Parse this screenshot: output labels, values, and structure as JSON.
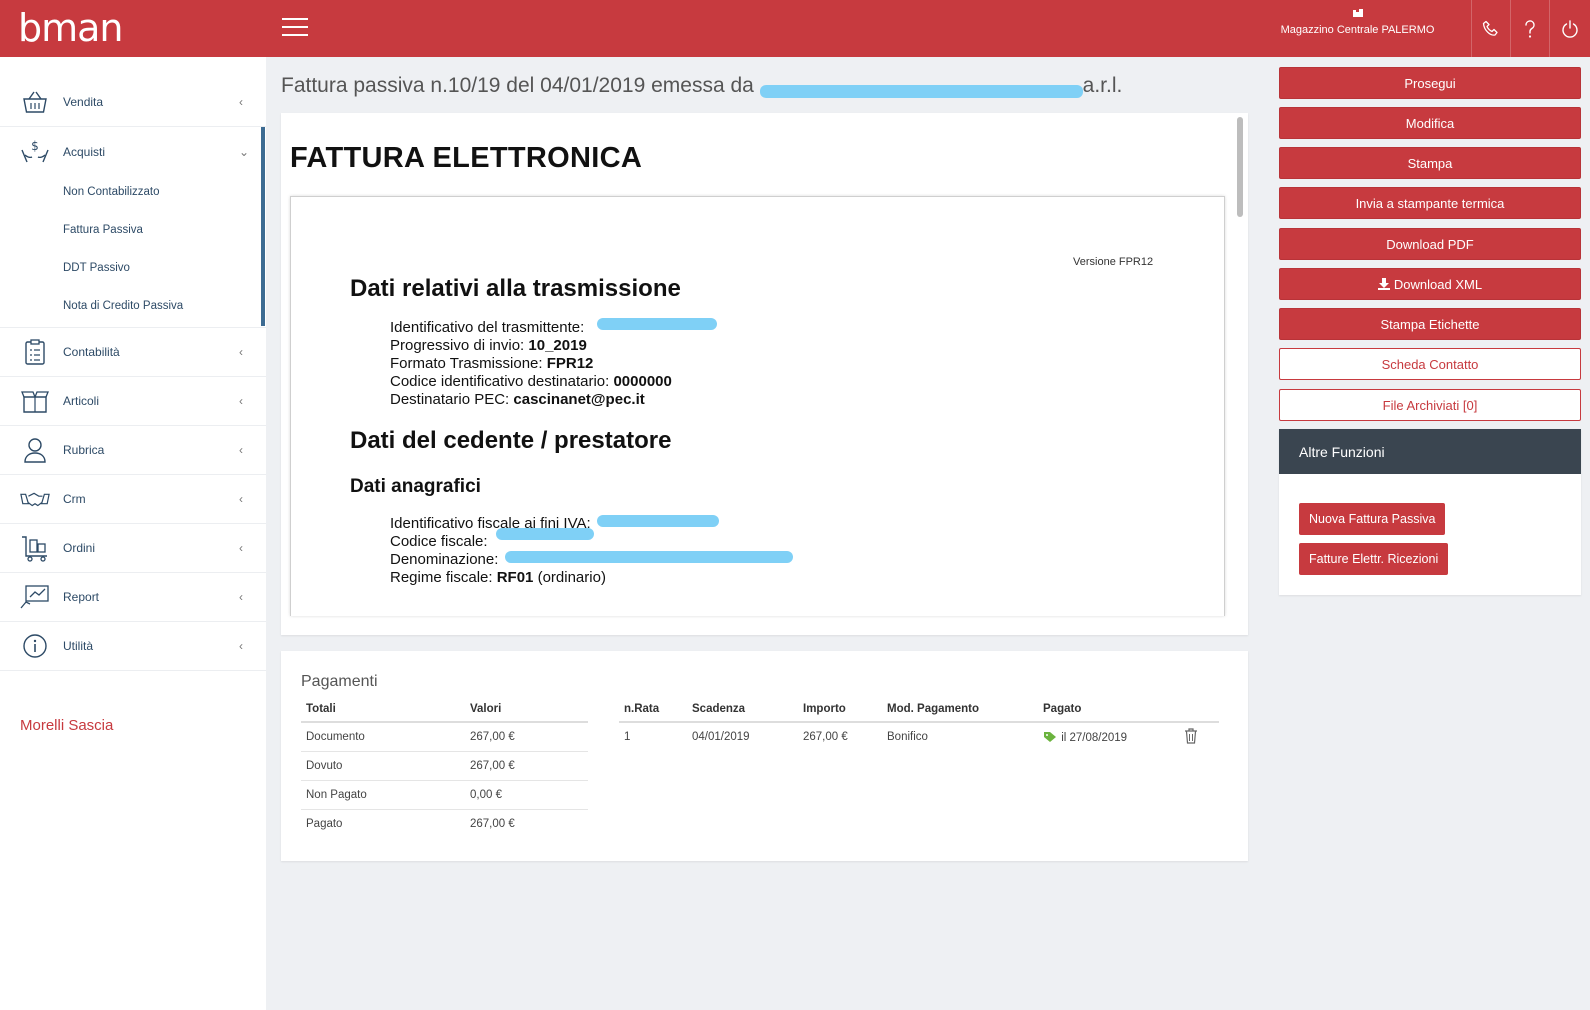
{
  "app": {
    "logo": "bman"
  },
  "header": {
    "warehouse": "Magazzino Centrale PALERMO",
    "icons": [
      "building-icon",
      "phone-icon",
      "help-icon",
      "power-icon"
    ]
  },
  "sidebar": {
    "items": [
      {
        "label": "Vendita",
        "icon": "basket-icon",
        "chevron": "‹"
      },
      {
        "label": "Acquisti",
        "icon": "hands-money-icon",
        "chevron": "⌄"
      },
      {
        "label": "Contabilità",
        "icon": "clipboard-icon",
        "chevron": "‹"
      },
      {
        "label": "Articoli",
        "icon": "box-icon",
        "chevron": "‹"
      },
      {
        "label": "Rubrica",
        "icon": "user-icon",
        "chevron": "‹"
      },
      {
        "label": "Crm",
        "icon": "handshake-icon",
        "chevron": "‹"
      },
      {
        "label": "Ordini",
        "icon": "cart-icon",
        "chevron": "‹"
      },
      {
        "label": "Report",
        "icon": "chart-icon",
        "chevron": "‹"
      },
      {
        "label": "Utilità",
        "icon": "info-icon",
        "chevron": "‹"
      }
    ],
    "acquisti_sub": [
      "Non Contabilizzato",
      "Fattura Passiva",
      "DDT Passivo",
      "Nota di Credito Passiva"
    ],
    "user_name": "Morelli Sascia"
  },
  "main": {
    "title_prefix": "Fattura passiva n.10/19 del 04/01/2019 emessa da",
    "title_suffix": "a.r.l."
  },
  "doc": {
    "heading": "FATTURA ELETTRONICA",
    "version": "Versione FPR12",
    "section1": "Dati relativi alla trasmissione",
    "trasmittente_label": "Identificativo del trasmittente:",
    "progressivo_label": "Progressivo di invio:",
    "progressivo_value": "10_2019",
    "formato_label": "Formato Trasmissione:",
    "formato_value": "FPR12",
    "codice_dest_label": "Codice identificativo destinatario:",
    "codice_dest_value": "0000000",
    "pec_label": "Destinatario PEC:",
    "pec_value": "cascinanet@pec.it",
    "section2": "Dati del cedente / prestatore",
    "section3": "Dati anagrafici",
    "iva_label": "Identificativo fiscale ai fini IVA:",
    "cf_label": "Codice fiscale:",
    "denom_label": "Denominazione:",
    "regime_label": "Regime fiscale:",
    "regime_value": "RF01",
    "regime_note": "(ordinario)"
  },
  "payments": {
    "title": "Pagamenti",
    "totals_headers": [
      "Totali",
      "Valori"
    ],
    "totals_rows": [
      [
        "Documento",
        "267,00 €"
      ],
      [
        "Dovuto",
        "267,00 €"
      ],
      [
        "Non Pagato",
        "0,00 €"
      ],
      [
        "Pagato",
        "267,00 €"
      ]
    ],
    "rate_headers": [
      "n.Rata",
      "Scadenza",
      "Importo",
      "Mod. Pagamento",
      "Pagato"
    ],
    "rate_rows": [
      {
        "n": "1",
        "scadenza": "04/01/2019",
        "importo": "267,00 €",
        "mod": "Bonifico",
        "pagato": "il 27/08/2019"
      }
    ]
  },
  "actions": {
    "prosegui": "Prosegui",
    "modifica": "Modifica",
    "stampa": "Stampa",
    "invia_termica": "Invia a stampante termica",
    "download_pdf": "Download PDF",
    "download_xml": "Download XML",
    "stampa_etichette": "Stampa Etichette",
    "scheda_contatto": "Scheda Contatto",
    "file_archiviati": "File Archiviati [0]"
  },
  "altre_funzioni": {
    "title": "Altre Funzioni",
    "nuova_fattura": "Nuova Fattura Passiva",
    "fatture_ricezioni": "Fatture Elettr. Ricezioni"
  },
  "colors": {
    "brand": "#c73a3f",
    "nav_text": "#2d4a66",
    "dark_panel": "#3a4550",
    "redaction": "#7fd0f6",
    "paid_tag": "#6bb33e"
  }
}
